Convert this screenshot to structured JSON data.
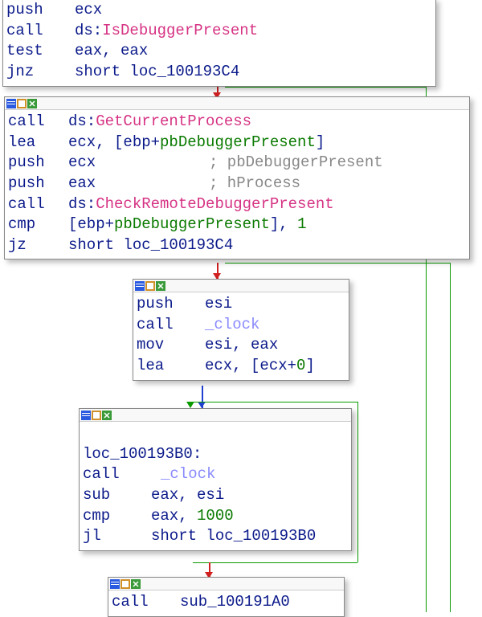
{
  "colors": {
    "mnemonic": "#0b1a8a",
    "api": "#d63384",
    "lib": "#8a8aff",
    "var": "#0a7a00",
    "num": "#0a7a00",
    "comment": "#888888",
    "edge_true": "#0a9a00",
    "edge_false": "#d02020",
    "edge_normal": "#2040d0"
  },
  "block0": {
    "lines": [
      {
        "mn": "push",
        "op": "ecx"
      },
      {
        "mn": "call",
        "op_ds": "ds:",
        "api": "IsDebuggerPresent"
      },
      {
        "mn": "test",
        "op": "eax, eax"
      },
      {
        "mn": "jnz",
        "op": "short loc_100193C4"
      }
    ]
  },
  "block1": {
    "lines": [
      {
        "mn": "call",
        "op_ds": "ds:",
        "api": "GetCurrentProcess"
      },
      {
        "mn": "lea",
        "op": "ecx, [ebp+",
        "var": "pbDebuggerPresent",
        "op2": "]"
      },
      {
        "mn": "push",
        "op": "ecx",
        "cmt": "; pbDebuggerPresent"
      },
      {
        "mn": "push",
        "op": "eax",
        "cmt": "; hProcess"
      },
      {
        "mn": "call",
        "op_ds": "ds:",
        "api": "CheckRemoteDebuggerPresent"
      },
      {
        "mn": "cmp",
        "op": "[ebp+",
        "var": "pbDebuggerPresent",
        "op2": "], ",
        "num": "1"
      },
      {
        "mn": "jz",
        "op": "short loc_100193C4"
      }
    ]
  },
  "block2": {
    "lines": [
      {
        "mn": "push",
        "op": "esi"
      },
      {
        "mn": "call",
        "lib": "_clock"
      },
      {
        "mn": "mov",
        "op": "esi, eax"
      },
      {
        "mn": "lea",
        "op": "ecx, [ecx+",
        "num": "0",
        "op2": "]"
      }
    ]
  },
  "block3": {
    "label": "loc_100193B0:",
    "lines": [
      {
        "mn": "call",
        "lib": "_clock"
      },
      {
        "mn": "sub",
        "op": "eax, esi"
      },
      {
        "mn": "cmp",
        "op": "eax, ",
        "num": "1000"
      },
      {
        "mn": "jl",
        "op": "short loc_100193B0"
      }
    ]
  },
  "block4": {
    "lines": [
      {
        "mn": "call",
        "op": "sub_100191A0"
      }
    ]
  },
  "chart_data": {
    "type": "table",
    "title": "IDA Pro disassembly graph view — anti-debugging routine",
    "blocks": [
      {
        "id": "entry",
        "instructions": [
          "push    ecx",
          "call    ds:IsDebuggerPresent",
          "test    eax, eax",
          "jnz     short loc_100193C4"
        ]
      },
      {
        "id": "b1",
        "instructions": [
          "call    ds:GetCurrentProcess",
          "lea     ecx, [ebp+pbDebuggerPresent]",
          "push    ecx             ; pbDebuggerPresent",
          "push    eax             ; hProcess",
          "call    ds:CheckRemoteDebuggerPresent",
          "cmp     [ebp+pbDebuggerPresent], 1",
          "jz      short loc_100193C4"
        ]
      },
      {
        "id": "b2",
        "instructions": [
          "push    esi",
          "call    _clock",
          "mov     esi, eax",
          "lea     ecx, [ecx+0]"
        ]
      },
      {
        "id": "loc_100193B0",
        "instructions": [
          "loc_100193B0:",
          "call    _clock",
          "sub     eax, esi",
          "cmp     eax, 1000",
          "jl      short loc_100193B0"
        ]
      },
      {
        "id": "b4",
        "instructions": [
          "call    sub_100191A0"
        ]
      }
    ],
    "edges": [
      {
        "from": "entry",
        "to": "b1",
        "type": "false_red"
      },
      {
        "from": "entry",
        "to": "loc_100193C4",
        "type": "true_green"
      },
      {
        "from": "b1",
        "to": "b2",
        "type": "false_red"
      },
      {
        "from": "b1",
        "to": "loc_100193C4",
        "type": "true_green"
      },
      {
        "from": "b2",
        "to": "loc_100193B0",
        "type": "unconditional_blue"
      },
      {
        "from": "loc_100193B0",
        "to": "loc_100193B0",
        "type": "true_green_loop"
      },
      {
        "from": "loc_100193B0",
        "to": "b4",
        "type": "false_red"
      }
    ]
  }
}
